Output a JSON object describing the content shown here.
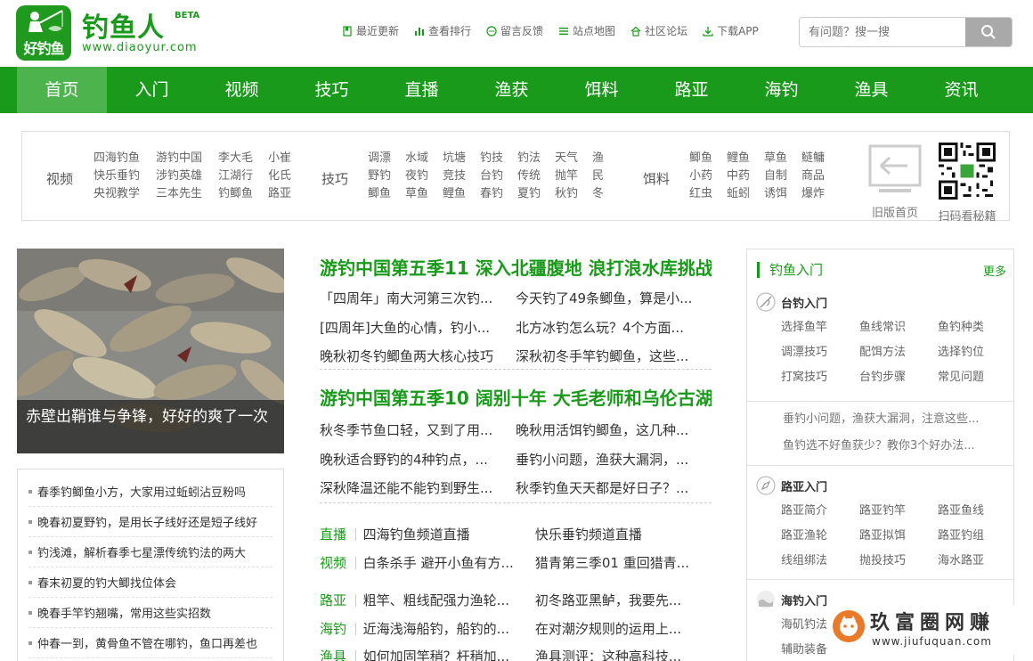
{
  "brand": {
    "badge": "好钓鱼",
    "name": "钓鱼人",
    "beta": "BETA",
    "domain": "www.diaoyur.com",
    "color": "#1a9a1a"
  },
  "topnav": [
    {
      "label": "最近更新",
      "icon": "bookmark-icon"
    },
    {
      "label": "查看排行",
      "icon": "bar-chart-icon"
    },
    {
      "label": "留言反馈",
      "icon": "chat-icon"
    },
    {
      "label": "站点地图",
      "icon": "list-icon"
    },
    {
      "label": "社区论坛",
      "icon": "home-icon"
    },
    {
      "label": "下载APP",
      "icon": "download-icon"
    }
  ],
  "search": {
    "placeholder": "有问题？搜一搜"
  },
  "mainnav": [
    "首页",
    "入门",
    "视频",
    "技巧",
    "直播",
    "渔获",
    "饵料",
    "路亚",
    "海钓",
    "渔具",
    "资讯"
  ],
  "categories": {
    "video": {
      "title": "视频",
      "items": [
        "四海钓鱼",
        "游钓中国",
        "李大毛",
        "小崔",
        "快乐垂钓",
        "涉钓英雄",
        "江湖行",
        "化氏",
        "央视教学",
        "三本先生",
        "钓鲫鱼",
        "路亚"
      ]
    },
    "skill": {
      "title": "技巧",
      "items": [
        "调漂",
        "水域",
        "坑塘",
        "钓技",
        "钓法",
        "天气",
        "渔",
        "野钓",
        "夜钓",
        "竞技",
        "台钓",
        "传统",
        "抛竿",
        "民",
        "鲫鱼",
        "草鱼",
        "鲤鱼",
        "春钓",
        "夏钓",
        "秋钓",
        "冬"
      ]
    },
    "bait": {
      "title": "饵料",
      "items": [
        "鲫鱼",
        "鲤鱼",
        "草鱼",
        "鲢鳙",
        "小药",
        "中药",
        "自制",
        "商品",
        "红虫",
        "蚯蚓",
        "诱饵",
        "爆炸"
      ]
    },
    "old_home": "旧版首页",
    "qr_label": "扫码看秘籍"
  },
  "feature": {
    "caption": "赤壁出鞘谁与争锋，好好的爽了一次"
  },
  "left_list": [
    "春季钓鲫鱼小方，大家用过蚯蚓沾豆粉吗",
    "晚春初夏野钓，是用长子线好还是短子线好",
    "钓浅滩，解析春季七星漂传统钓法的两大",
    "春末初夏的钓大鲫找位体会",
    "晚春手竿钓翘嘴，常用这些实招数",
    "仲春一到，黄骨鱼不管在哪钓，鱼口再差也"
  ],
  "center": {
    "headline1": "游钓中国第五季11 深入北疆腹地 浪打浪水库挑战",
    "block1": [
      [
        "「四周年」南大河第三次钓...",
        "今天钓了49条鲫鱼，算是小..."
      ],
      [
        "[四周年]大鱼的心情，钓小...",
        "北方冰钓怎么玩？4个方面..."
      ],
      [
        "晚秋初冬钓鲫鱼两大核心技巧",
        "深秋初冬手竿钓鲫鱼，这些..."
      ]
    ],
    "headline2": "游钓中国第五季10 阔别十年 大毛老师和乌伦古湖",
    "block2": [
      [
        "秋冬季节鱼口轻，又到了用...",
        "晚秋用活饵钓鲫鱼，这几种..."
      ],
      [
        "晚秋适合野钓的4种钓点，...",
        "垂钓小问题，渔获大漏洞，..."
      ],
      [
        "深秋降温还能不能钓到野生...",
        "秋季钓鱼天天都是好日子？..."
      ]
    ],
    "catrows": [
      {
        "tag": "直播",
        "c1": "四海钓鱼频道直播",
        "c2": "快乐垂钓频道直播"
      },
      {
        "tag": "视频",
        "c1": "白条杀手 避开小鱼有方...",
        "c2": "猎青第三季01 重回猎青..."
      },
      {
        "tag": "路亚",
        "c1": "粗竿、粗线配强力渔轮...",
        "c2": "初冬路亚黑鲈，我要先..."
      },
      {
        "tag": "海钓",
        "c1": "近海浅海船钓，船钓的...",
        "c2": "在对潮汐规则的运用上..."
      },
      {
        "tag": "渔具",
        "c1": "如何加固竿稍？杆稍加...",
        "c2": "渔具测评：这种高科技..."
      }
    ]
  },
  "sidebar": {
    "title": "钓鱼入门",
    "more": "更多",
    "sections": [
      {
        "title": "台钓入门",
        "icon": "fishing-rod-icon",
        "links": [
          "选择鱼竿",
          "鱼线常识",
          "鱼钓种类",
          "调漂技巧",
          "配饵方法",
          "选择钓位",
          "打窝技巧",
          "台钓步骤",
          "常见问题"
        ]
      },
      {
        "title": "路亚入门",
        "icon": "compass-icon",
        "links": [
          "路亚简介",
          "路亚钓竿",
          "路亚鱼线",
          "路亚渔轮",
          "路亚拟饵",
          "路亚钓组",
          "线组绑法",
          "抛投技巧",
          "海水路亚"
        ]
      },
      {
        "title": "海钓入门",
        "icon": "wave-icon",
        "links": [
          "海矶钓法",
          "",
          "",
          "辅助装备",
          "",
          ""
        ]
      }
    ],
    "notes": [
      "垂钓小问题，渔获大漏洞，注意这些...",
      "鱼钓选不好鱼获少？教你3个好办法..."
    ]
  },
  "watermark": {
    "text": "玖富圈网赚",
    "url": "www.jiufuquan.com"
  }
}
